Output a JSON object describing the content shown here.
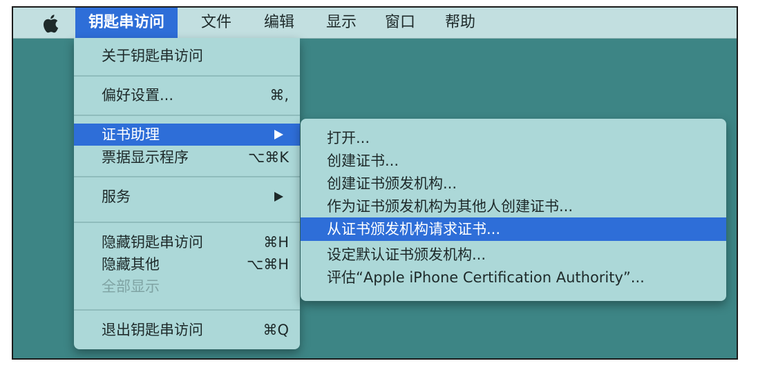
{
  "menubar": {
    "items": [
      "钥匙串访问",
      "文件",
      "编辑",
      "显示",
      "窗口",
      "帮助"
    ]
  },
  "app_menu": {
    "about": "关于钥匙串访问",
    "preferences": {
      "label": "偏好设置...",
      "shortcut": "⌘,"
    },
    "cert_assistant": "证书助理",
    "ticket_viewer": {
      "label": "票据显示程序",
      "shortcut": "⌥⌘K"
    },
    "services": "服务",
    "hide": {
      "label": "隐藏钥匙串访问",
      "shortcut": "⌘H"
    },
    "hide_others": {
      "label": "隐藏其他",
      "shortcut": "⌥⌘H"
    },
    "show_all": "全部显示",
    "quit": {
      "label": "退出钥匙串访问",
      "shortcut": "⌘Q"
    }
  },
  "submenu": {
    "items": [
      "打开...",
      "创建证书...",
      "创建证书颁发机构...",
      "作为证书颁发机构为其他人创建证书...",
      "从证书颁发机构请求证书...",
      "设定默认证书颁发机构...",
      "评估“Apple iPhone Certification Authority”..."
    ]
  },
  "colors": {
    "desktop": "#3d8585",
    "menu_background": "#acd8d8",
    "highlight": "#2e6ed8"
  }
}
